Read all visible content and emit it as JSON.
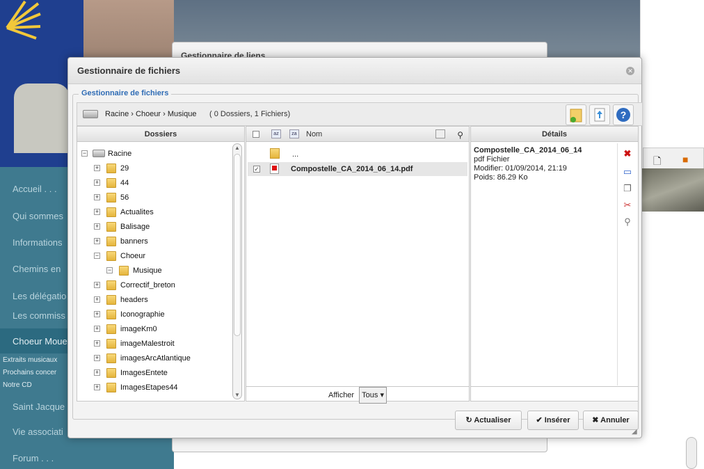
{
  "background": {
    "nav_items": [
      "Accueil . . .",
      "Qui sommes",
      "Informations",
      "Chemins en",
      "Les délégatio",
      "Les commiss",
      "Choeur Moue",
      "Saint Jacque",
      "Vie associati",
      "Forum . . ."
    ],
    "sub_items": [
      "Extraits musicaux",
      "Prochains concer",
      "Notre CD"
    ],
    "back_dialog_title": "Gestionnaire de liens"
  },
  "dialog": {
    "title": "Gestionnaire de fichiers",
    "legend": "Gestionnaire de fichiers",
    "path": "Racine › Choeur › Musique",
    "count": "( 0 Dossiers, 1 Fichiers)"
  },
  "folders_panel": {
    "header": "Dossiers",
    "root": "Racine",
    "items": [
      "29",
      "44",
      "56",
      "Actualites",
      "Balisage",
      "banners",
      "Choeur",
      "Musique",
      "Correctif_breton",
      "headers",
      "Iconographie",
      "imageKm0",
      "imageMalestroit",
      "imagesArcAtlantique",
      "ImagesEntete",
      "ImagesEtapes44"
    ]
  },
  "files_panel": {
    "header_name": "Nom",
    "parent": "...",
    "files": [
      "Compostelle_CA_2014_06_14.pdf"
    ],
    "show_label": "Afficher",
    "show_value": "Tous"
  },
  "details_panel": {
    "header": "Détails",
    "name": "Compostelle_CA_2014_06_14",
    "type": "pdf Fichier",
    "modified": "Modifier: 01/09/2014, 21:19",
    "size": "Poids: 86.29 Ko"
  },
  "actions": {
    "refresh": "Actualiser",
    "insert": "Insérer",
    "cancel": "Annuler"
  },
  "colors": {
    "accent": "#2f6cb5",
    "nav": "#3f7a8f",
    "delete": "#cc1111"
  }
}
